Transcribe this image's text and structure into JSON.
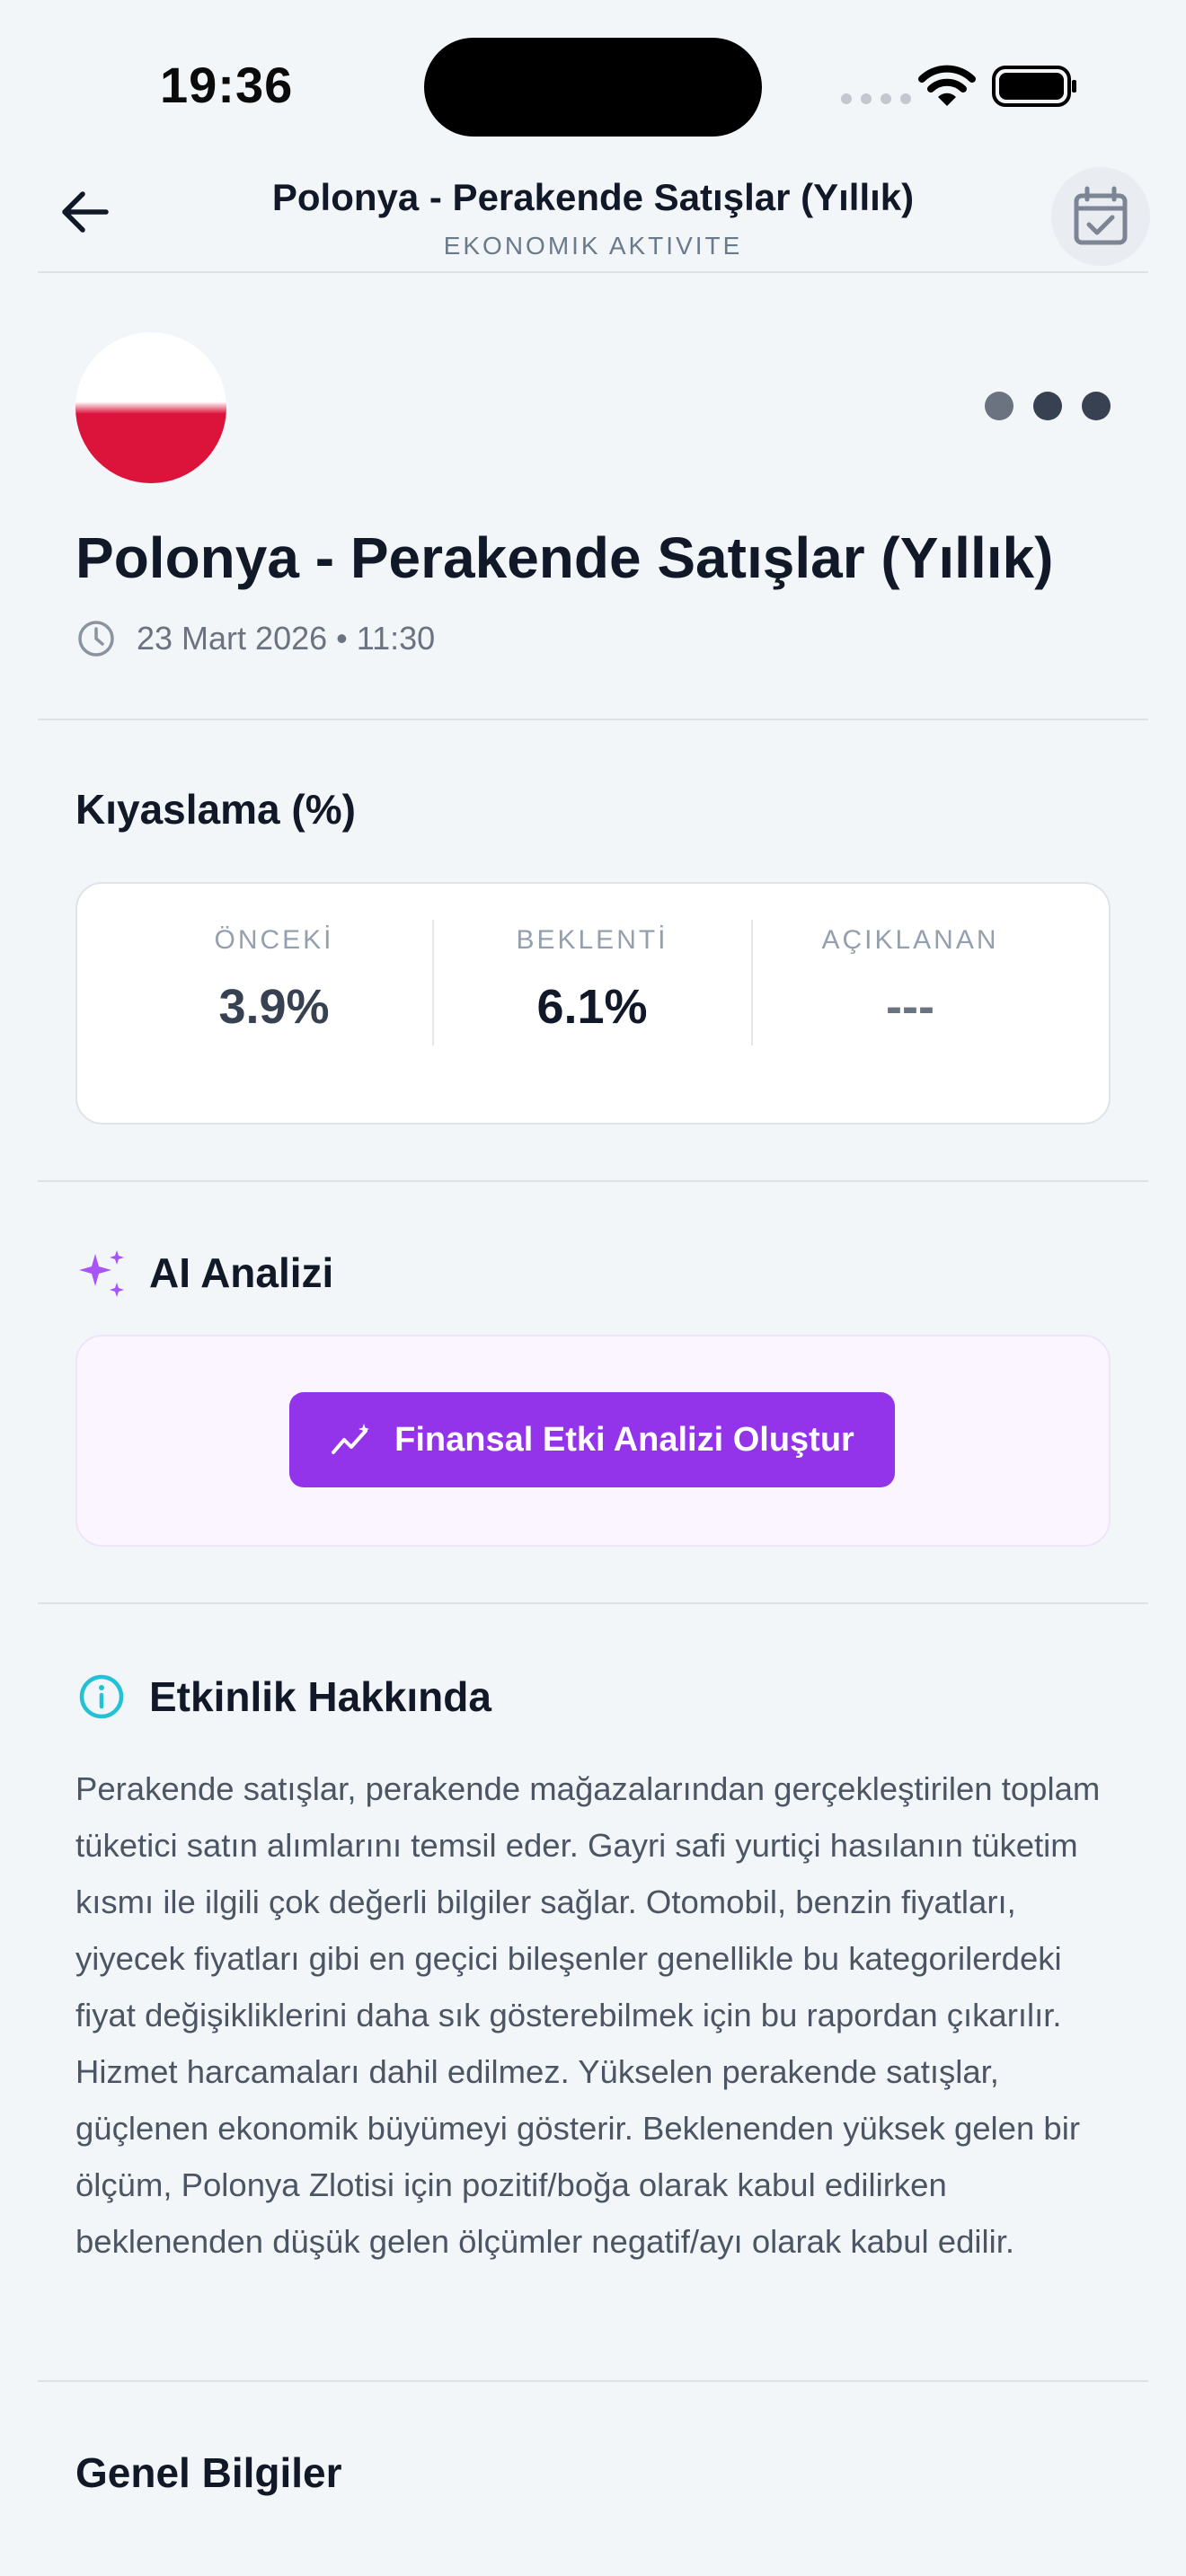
{
  "status_bar": {
    "time": "19:36"
  },
  "header": {
    "title": "Polonya - Perakende Satışlar (Yıllık)",
    "subtitle": "EKONOMIK AKTIVITE"
  },
  "event": {
    "title": "Polonya - Perakende Satışlar (Yıllık)",
    "date": "23 Mart 2026 • 11:30",
    "importance_dots": [
      "#6b7280",
      "#374151",
      "#374151"
    ]
  },
  "comparison": {
    "title": "Kıyaslama (%)",
    "columns": [
      {
        "label": "ÖNCEKİ",
        "value": "3.9%",
        "color": "#374151"
      },
      {
        "label": "BEKLENTİ",
        "value": "6.1%",
        "color": "#111827"
      },
      {
        "label": "AÇIKLANAN",
        "value": "---",
        "color": "#6b7280"
      }
    ]
  },
  "ai": {
    "title": "AI Analizi",
    "button_label": "Finansal Etki Analizi Oluştur",
    "accent": "#9333ea"
  },
  "about": {
    "title": "Etkinlik Hakkında",
    "text": "Perakende satışlar, perakende mağazalarından gerçekleştirilen toplam tüketici satın alımlarını temsil eder. Gayri safi yurtiçi hasılanın tüketim kısmı ile ilgili çok değerli bilgiler sağlar. Otomobil, benzin fiyatları, yiyecek fiyatları gibi en geçici bileşenler genellikle bu kategorilerdeki fiyat değişikliklerini daha sık gösterebilmek için bu rapordan çıkarılır. Hizmet harcamaları dahil edilmez. Yükselen perakende satışlar, güçlenen ekonomik büyümeyi gösterir. Beklenenden yüksek gelen bir ölçüm, Polonya Zlotisi için pozitif/boğa olarak kabul edilirken beklenenden düşük gelen ölçümler negatif/ayı olarak kabul edilir."
  },
  "general": {
    "title": "Genel Bilgiler"
  }
}
